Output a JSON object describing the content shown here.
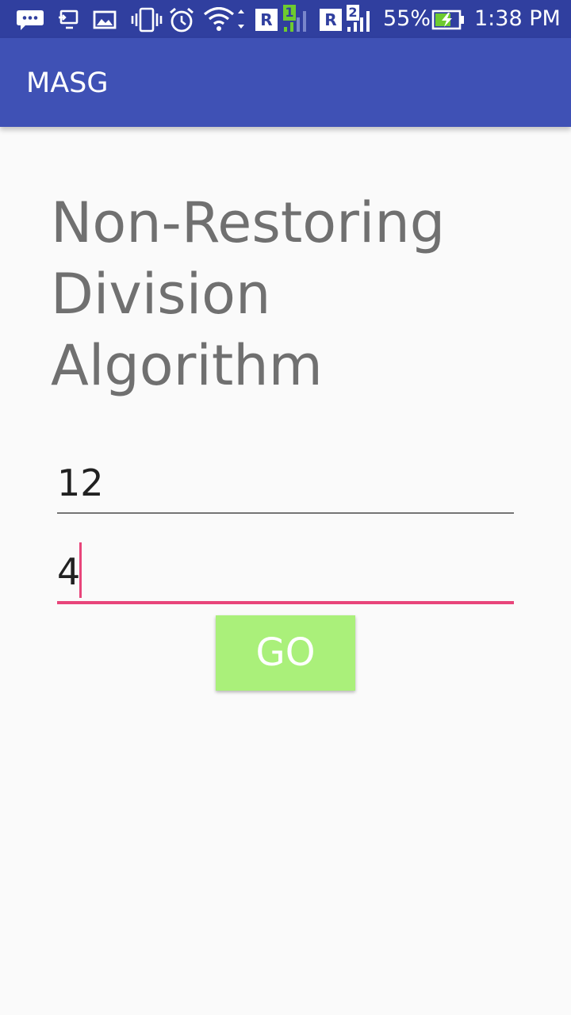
{
  "status_bar": {
    "battery_percent": "55%",
    "time": "1:38 PM",
    "sim1_label": "R",
    "sim1_number": "1",
    "sim2_label": "R",
    "sim2_number": "2",
    "icons": [
      "chat-bubble-icon",
      "cast-icon",
      "image-icon",
      "vibrate-icon",
      "alarm-icon",
      "wifi-icon",
      "signal-sim1-icon",
      "signal-sim2-icon",
      "battery-charging-icon"
    ],
    "colors": {
      "background": "#303f9f",
      "battery_fill": "#6ecb2f",
      "sim1_badge": "#6ecb2f"
    }
  },
  "app_bar": {
    "title": "MASG",
    "color": "#3f51b5"
  },
  "main": {
    "heading_lines": [
      "Non-Restoring",
      "Division",
      "Algorithm"
    ],
    "dividend_value": "12",
    "divisor_value": "4",
    "go_label": "GO",
    "colors": {
      "accent": "#e8457a",
      "go_button": "#aaf07a",
      "heading": "#707070"
    }
  }
}
